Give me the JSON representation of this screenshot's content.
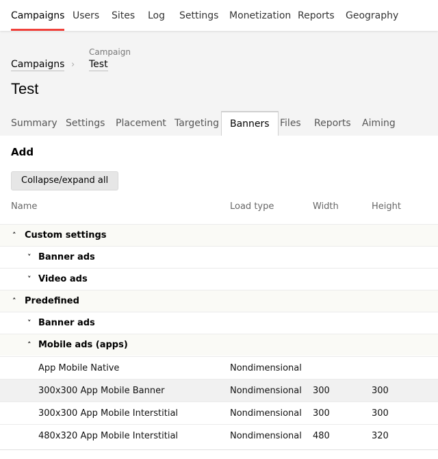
{
  "nav": {
    "items": [
      {
        "label": "Campaigns",
        "active": true
      },
      {
        "label": "Users"
      },
      {
        "label": "Sites"
      },
      {
        "label": "Log"
      },
      {
        "label": "Settings"
      },
      {
        "label": "Monetization"
      },
      {
        "label": "Reports"
      },
      {
        "label": "Geography"
      }
    ],
    "accent_color": "#f0403a"
  },
  "breadcrumb": {
    "root": "Campaigns",
    "current_caption": "Campaign",
    "current": "Test"
  },
  "page_title": "Test",
  "tabs": [
    {
      "label": "Summary"
    },
    {
      "label": "Settings"
    },
    {
      "label": "Placement"
    },
    {
      "label": "Targeting"
    },
    {
      "label": "Banners",
      "active": true
    },
    {
      "label": "Files"
    },
    {
      "label": "Reports"
    },
    {
      "label": "Aiming"
    }
  ],
  "main": {
    "add_label": "Add",
    "collapse_button": "Collapse/expand all",
    "columns": [
      "Name",
      "Load type",
      "Width",
      "Height"
    ]
  },
  "groups": [
    {
      "label": "Custom settings",
      "expanded": true,
      "icon": "chevron-up-icon",
      "level": 0
    },
    {
      "label": "Banner ads",
      "expanded": false,
      "icon": "chevron-down-icon",
      "level": 1
    },
    {
      "label": "Video ads",
      "expanded": false,
      "icon": "chevron-down-icon",
      "level": 1
    },
    {
      "label": "Predefined",
      "expanded": true,
      "icon": "chevron-up-icon",
      "level": 0
    },
    {
      "label": "Banner ads",
      "expanded": false,
      "icon": "chevron-down-icon",
      "level": 1
    },
    {
      "label": "Mobile ads (apps)",
      "expanded": true,
      "icon": "chevron-up-icon",
      "level": 1
    }
  ],
  "banners": [
    {
      "name": "App Mobile Native",
      "load_type": "Nondimensional",
      "width": "",
      "height": ""
    },
    {
      "name": "300x300 App Mobile Banner",
      "load_type": "Nondimensional",
      "width": "300",
      "height": "300"
    },
    {
      "name": "300x300 App Mobile Interstitial",
      "load_type": "Nondimensional",
      "width": "300",
      "height": "300"
    },
    {
      "name": "480x320 App Mobile Interstitial",
      "load_type": "Nondimensional",
      "width": "480",
      "height": "320"
    }
  ]
}
